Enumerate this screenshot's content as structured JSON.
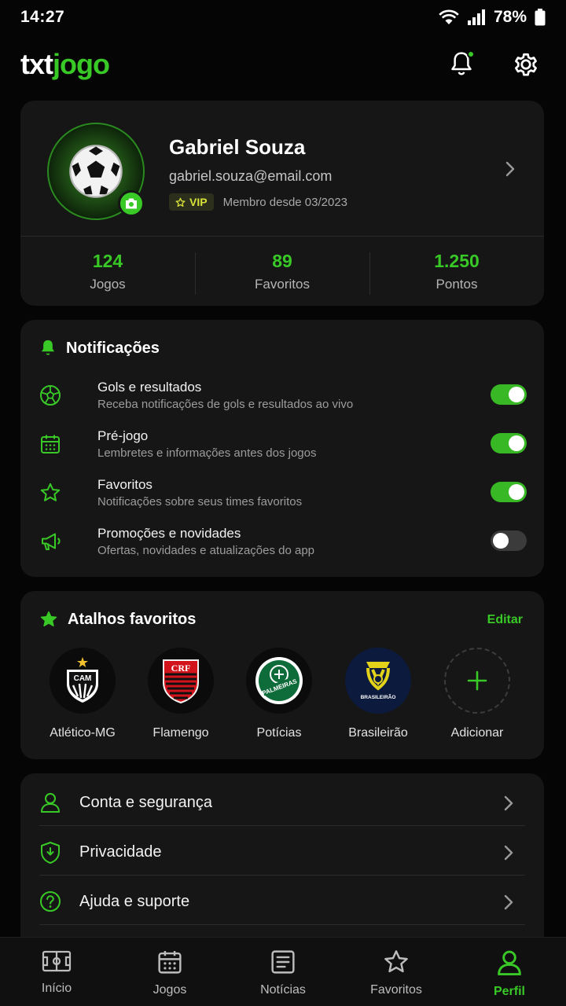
{
  "status_bar": {
    "time": "14:27",
    "battery": "78%"
  },
  "header": {
    "logo_part1": "txt",
    "logo_part2": "jogo"
  },
  "profile": {
    "name": "Gabriel Souza",
    "email": "gabriel.souza@email.com",
    "vip_label": "VIP",
    "member_since": "Membro desde 03/2023",
    "stats": [
      {
        "value": "124",
        "label": "Jogos"
      },
      {
        "value": "89",
        "label": "Favoritos"
      },
      {
        "value": "1.250",
        "label": "Pontos"
      }
    ]
  },
  "notifications": {
    "title": "Notificações",
    "items": [
      {
        "title": "Gols e resultados",
        "description": "Receba notificações de gols e resultados ao vivo",
        "icon": "soccer-ball-icon",
        "enabled": true
      },
      {
        "title": "Pré-jogo",
        "description": "Lembretes e informações antes dos jogos",
        "icon": "calendar-icon",
        "enabled": true
      },
      {
        "title": "Favoritos",
        "description": "Notificações sobre seus times favoritos",
        "icon": "star-icon",
        "enabled": true
      },
      {
        "title": "Promoções e novidades",
        "description": "Ofertas, novidades e atualizações do app",
        "icon": "megaphone-icon",
        "enabled": false
      }
    ]
  },
  "shortcuts": {
    "title": "Atalhos favoritos",
    "edit_label": "Editar",
    "items": [
      {
        "label": "Atlético-MG",
        "crest_text": "CAM"
      },
      {
        "label": "Flamengo",
        "crest_text": "CRF"
      },
      {
        "label": "Potícias",
        "crest_text": "PALMEIRAS"
      },
      {
        "label": "Brasileirão",
        "crest_text": "BRASILEIRÃO"
      },
      {
        "label": "Adicionar",
        "crest_text": "+"
      }
    ]
  },
  "menu": {
    "items": [
      {
        "label": "Conta e segurança",
        "icon": "user-icon"
      },
      {
        "label": "Privacidade",
        "icon": "shield-icon"
      },
      {
        "label": "Ajuda e suporte",
        "icon": "help-icon"
      }
    ]
  },
  "bottom_nav": {
    "items": [
      {
        "label": "Início",
        "icon": "field-icon",
        "active": false
      },
      {
        "label": "Jogos",
        "icon": "calendar-icon",
        "active": false
      },
      {
        "label": "Notícias",
        "icon": "news-icon",
        "active": false
      },
      {
        "label": "Favoritos",
        "icon": "star-icon",
        "active": false
      },
      {
        "label": "Perfil",
        "icon": "user-icon",
        "active": true
      }
    ]
  },
  "colors": {
    "accent": "#39c927",
    "background": "#050505",
    "card": "#161616",
    "vip": "#d8e23a"
  }
}
